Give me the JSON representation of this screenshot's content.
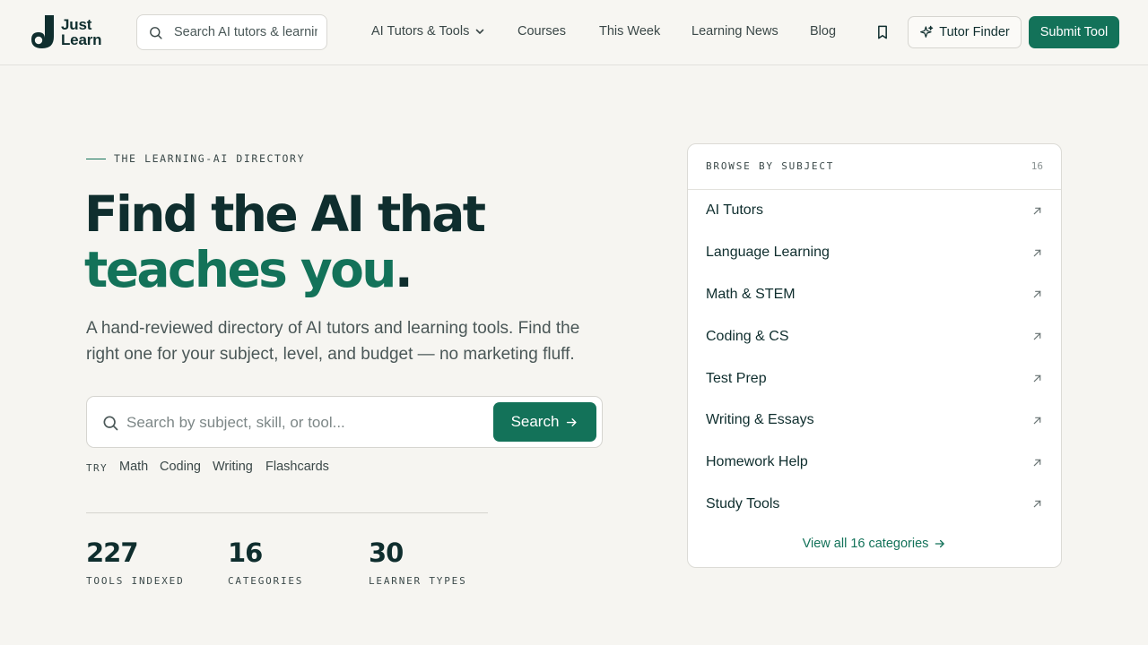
{
  "brand": {
    "line1": "Just",
    "line2": "Learn"
  },
  "header": {
    "search_placeholder": "Search AI tutors & learning tools",
    "nav": [
      {
        "label": "AI Tutors & Tools",
        "has_dropdown": true
      },
      {
        "label": "Courses"
      },
      {
        "label": "This Week"
      },
      {
        "label": "Learning News"
      },
      {
        "label": "Blog"
      }
    ],
    "tutor_finder_label": "Tutor Finder",
    "submit_label": "Submit Tool",
    "icons": {
      "search": "search-icon",
      "bookmark": "bookmark-icon",
      "sparkle": "sparkle-icon",
      "chevron": "chevron-down-icon"
    }
  },
  "hero": {
    "eyebrow": "THE LEARNING-AI DIRECTORY",
    "headline_line1": "Find the AI that",
    "headline_green": "teaches you",
    "headline_period": ".",
    "subtitle": "A hand-reviewed directory of AI tutors and learning tools. Find the right one for your subject, level, and budget — no marketing fluff.",
    "search_placeholder": "Search by subject, skill, or tool...",
    "search_button": "Search",
    "try_label": "TRY",
    "try_chips": [
      "Math",
      "Coding",
      "Writing",
      "Flashcards"
    ],
    "stats": [
      {
        "value": "227",
        "label": "TOOLS INDEXED"
      },
      {
        "value": "16",
        "label": "CATEGORIES"
      },
      {
        "value": "30",
        "label": "LEARNER TYPES"
      }
    ]
  },
  "browse": {
    "title": "BROWSE BY SUBJECT",
    "count": "16",
    "categories": [
      "AI Tutors",
      "Language Learning",
      "Math & STEM",
      "Coding & CS",
      "Test Prep",
      "Writing & Essays",
      "Homework Help",
      "Study Tools"
    ],
    "view_all": "View all 16 categories"
  },
  "colors": {
    "brand_green": "#137259",
    "ink": "#0f2e2e",
    "background": "#f6f5f1"
  }
}
